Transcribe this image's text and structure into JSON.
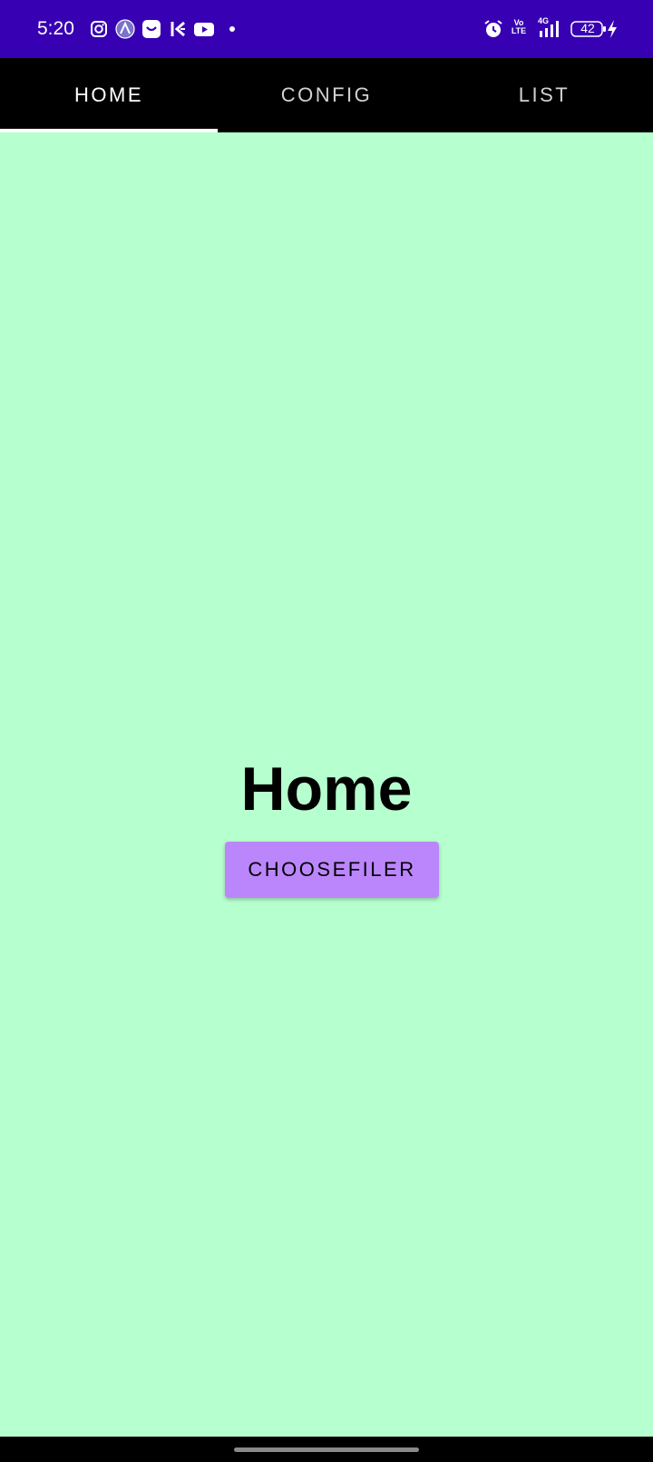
{
  "status_bar": {
    "time": "5:20",
    "battery": "42",
    "network": "4G",
    "volte": "Vo\nLTE",
    "background": "#3700b3",
    "icons": [
      "instagram-icon",
      "arc-icon",
      "smile-app-icon",
      "kite-icon",
      "youtube-icon",
      "notification-dot-icon",
      "alarm-icon",
      "volte-icon",
      "signal-icon",
      "battery-icon",
      "charging-icon"
    ]
  },
  "tabs": [
    {
      "label": "HOME",
      "active": true
    },
    {
      "label": "CONFIG",
      "active": false
    },
    {
      "label": "LIST",
      "active": false
    }
  ],
  "main": {
    "title": "Home",
    "button_label": "CHOOSEFILER",
    "background": "#b6ffce",
    "button_color": "#bb86fc"
  }
}
